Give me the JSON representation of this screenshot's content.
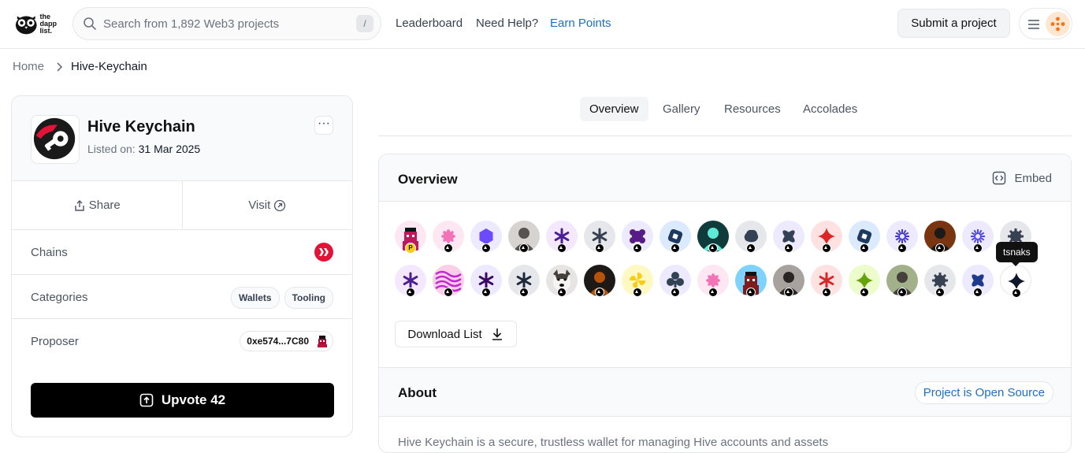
{
  "header": {
    "logo_lines": [
      "the",
      "dapp",
      "list."
    ],
    "search_placeholder": "Search from 1,892 Web3 projects",
    "search_shortcut": "/",
    "nav": [
      "Leaderboard",
      "Need Help?",
      "Earn Points"
    ],
    "submit_label": "Submit a project"
  },
  "breadcrumb": {
    "home": "Home",
    "current": "Hive-Keychain"
  },
  "project": {
    "name": "Hive Keychain",
    "listed_label": "Listed on:",
    "listed_date": "31 Mar 2025",
    "more_label": "···",
    "share_label": "Share",
    "visit_label": "Visit",
    "chains_label": "Chains",
    "categories_label": "Categories",
    "categories": [
      "Wallets",
      "Tooling"
    ],
    "proposer_label": "Proposer",
    "proposer_address": "0xe574...7C80",
    "upvote_label": "Upvote 42",
    "brand_color": "#e31337"
  },
  "tabs": [
    "Overview",
    "Gallery",
    "Resources",
    "Accolades"
  ],
  "overview": {
    "title": "Overview",
    "embed_label": "Embed",
    "tooltip": "tsnaks",
    "download_label": "Download List",
    "voters_row1": [
      {
        "icon": "pixel-avatar",
        "bg": "#fce7f3",
        "color": "#be185d",
        "badge": "P"
      },
      {
        "icon": "flower-icon",
        "bg": "#fce7f3",
        "color": "#f472b6"
      },
      {
        "icon": "hexagon-icon",
        "bg": "#ede9fe",
        "color": "#6d4aff"
      },
      {
        "icon": "photo-avatar",
        "bg": "#d6d3d1",
        "color": "#57534e"
      },
      {
        "icon": "asterisk-icon",
        "bg": "#f3e8ff",
        "color": "#4c1d95"
      },
      {
        "icon": "asterisk-icon",
        "bg": "#e5e7eb",
        "color": "#374151"
      },
      {
        "icon": "blob-icon",
        "bg": "#ede9fe",
        "color": "#581c87"
      },
      {
        "icon": "rounded-square-icon",
        "bg": "#dbeafe",
        "color": "#1e3a5f"
      },
      {
        "icon": "photo-avatar",
        "bg": "#0f3b3a",
        "color": "#5eead4"
      },
      {
        "icon": "cloud-icon",
        "bg": "#e5e7eb",
        "color": "#334155"
      },
      {
        "icon": "x-shape-icon",
        "bg": "#ede9fe",
        "color": "#334155"
      },
      {
        "icon": "sparkle-icon",
        "bg": "#fee2e2",
        "color": "#dc2626"
      },
      {
        "icon": "rounded-square-icon",
        "bg": "#dbeafe",
        "color": "#1e3a5f"
      },
      {
        "icon": "burst-icon",
        "bg": "#ede9fe",
        "color": "#4338ca"
      },
      {
        "icon": "photo-avatar",
        "bg": "#78350f",
        "color": "#1c1917"
      },
      {
        "icon": "burst-icon",
        "bg": "#ede9fe",
        "color": "#4f46e5"
      },
      {
        "icon": "gear-icon",
        "bg": "#e5e7eb",
        "color": "#374151"
      }
    ],
    "voters_row2": [
      {
        "icon": "asterisk-icon",
        "bg": "#f3e8ff",
        "color": "#4c1d95"
      },
      {
        "icon": "pattern-avatar",
        "bg": "#fbcfe8",
        "color": "#c026d3"
      },
      {
        "icon": "asterisk-icon",
        "bg": "#ede9fe",
        "color": "#3b0764"
      },
      {
        "icon": "asterisk-icon",
        "bg": "#e5e7eb",
        "color": "#1e293b"
      },
      {
        "icon": "dog-avatar",
        "bg": "#e7e5e4",
        "color": "#44403c"
      },
      {
        "icon": "photo-avatar",
        "bg": "#1c1917",
        "color": "#b45309"
      },
      {
        "icon": "pinwheel-icon",
        "bg": "#fef9c3",
        "color": "#facc15"
      },
      {
        "icon": "club-icon",
        "bg": "#ede9fe",
        "color": "#334155"
      },
      {
        "icon": "flower-icon",
        "bg": "#fce7f3",
        "color": "#f472b6"
      },
      {
        "icon": "pixel-avatar",
        "bg": "#7dd3fc",
        "color": "#7f1d1d"
      },
      {
        "icon": "photo-avatar",
        "bg": "#a8a29e",
        "color": "#292524"
      },
      {
        "icon": "asterisk-icon",
        "bg": "#fee2e2",
        "color": "#dc2626"
      },
      {
        "icon": "sparkle-icon",
        "bg": "#ecfccb",
        "color": "#65a30d"
      },
      {
        "icon": "photo-avatar",
        "bg": "#a3b18a",
        "color": "#44403c"
      },
      {
        "icon": "gear-icon",
        "bg": "#e5e7eb",
        "color": "#374151"
      },
      {
        "icon": "x-shape-icon",
        "bg": "#ede9fe",
        "color": "#1e3a8a"
      },
      {
        "icon": "sparkle-icon",
        "bg": "#ffffff",
        "color": "#0f172a"
      }
    ]
  },
  "about": {
    "title": "About",
    "oss_label": "Project is Open Source",
    "text": "Hive Keychain is a secure, trustless wallet for managing Hive accounts and assets"
  }
}
